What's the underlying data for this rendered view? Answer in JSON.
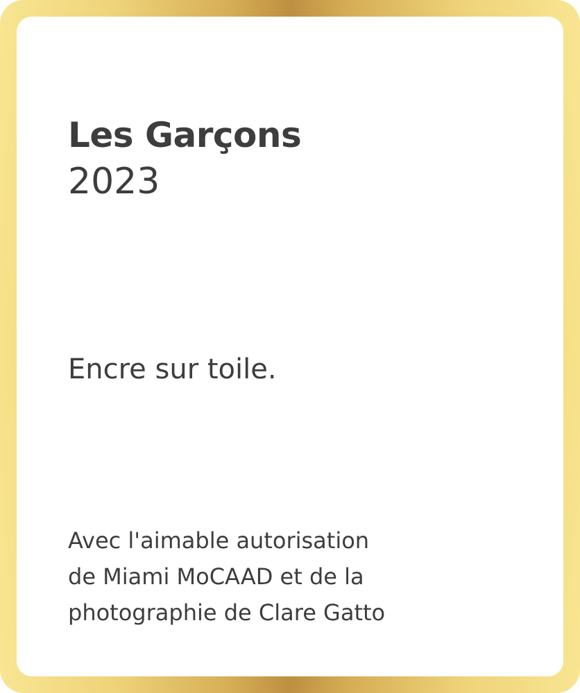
{
  "artwork": {
    "title": "Les Garçons",
    "year": "2023",
    "medium": "Encre sur toile.",
    "credit_lines": [
      "Avec l'aimable autorisation",
      "de Miami MoCAAD et de la",
      "photographie de Clare Gatto"
    ]
  },
  "colors": {
    "frame_gold": "#c8973a",
    "frame_light_gold": "#f7e28a",
    "card_background": "#ffffff",
    "text": "#3d3d3d"
  }
}
